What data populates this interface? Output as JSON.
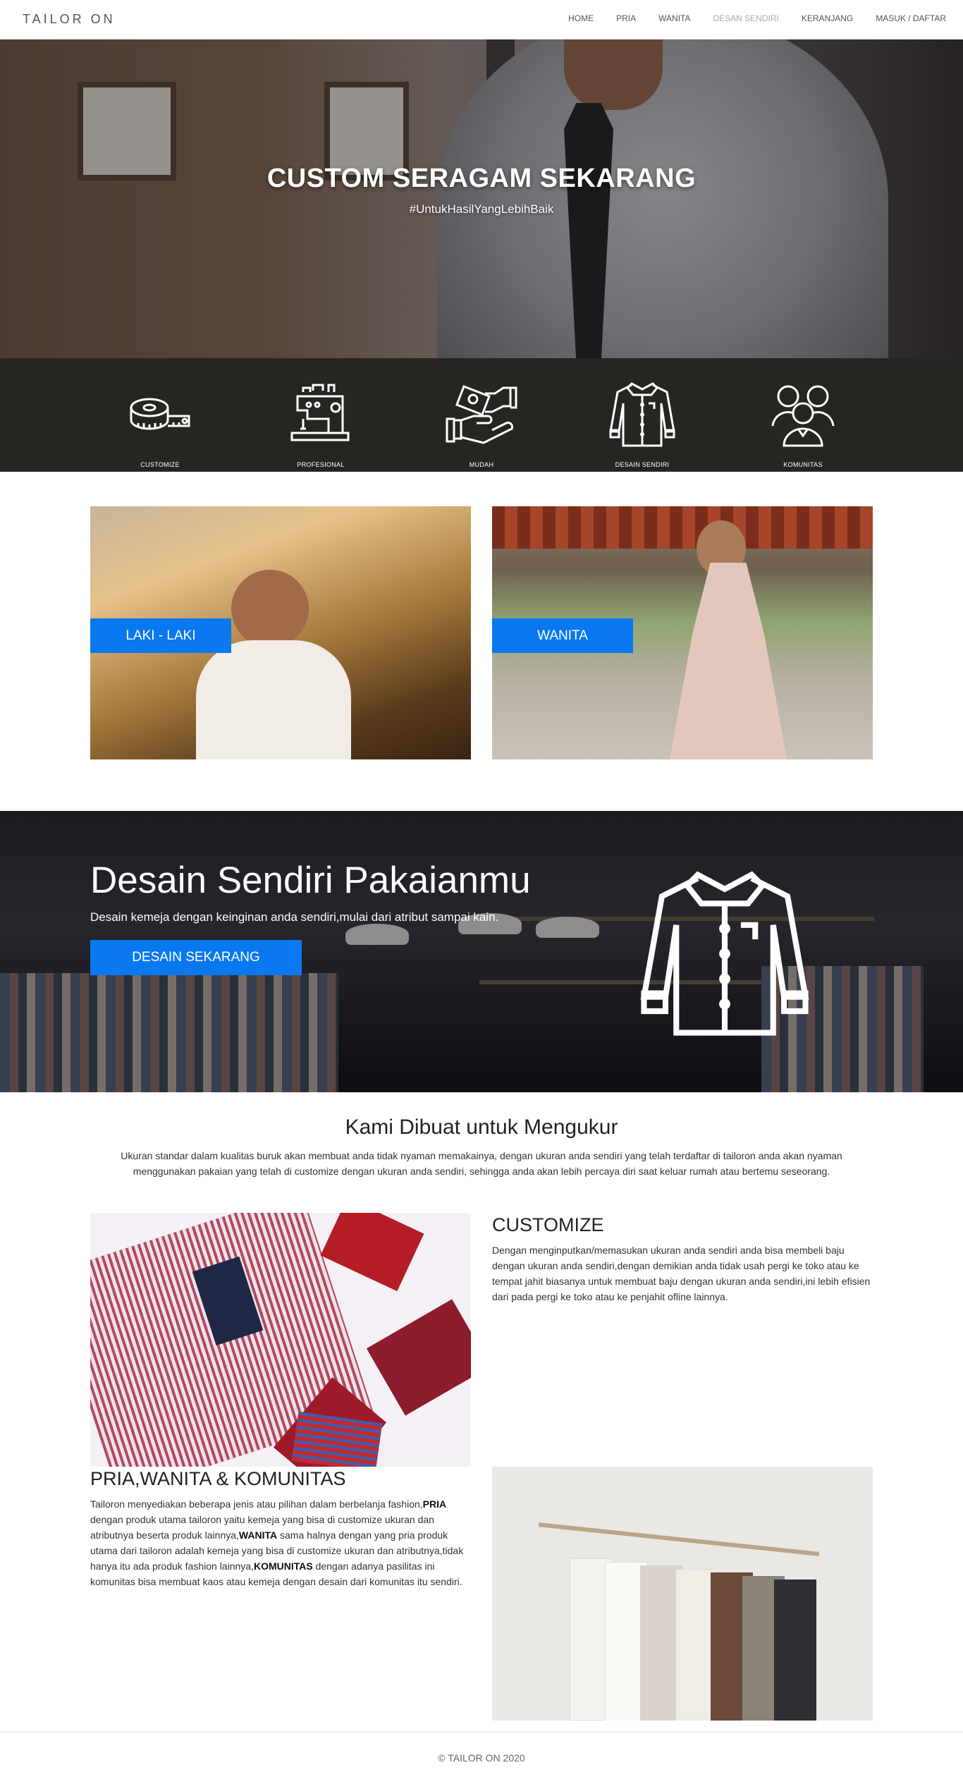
{
  "nav": {
    "brand": "TAILOR ON",
    "items": [
      {
        "label": "HOME"
      },
      {
        "label": "PRIA"
      },
      {
        "label": "WANITA"
      },
      {
        "label": "DESAN SENDIRI"
      },
      {
        "label": "KERANJANG"
      },
      {
        "label": "MASUK / DAFTAR"
      }
    ]
  },
  "hero": {
    "title": "CUSTOM SERAGAM SEKARANG",
    "subtitle": "#UntukHasilYangLebihBaik"
  },
  "features": [
    {
      "label": "CUSTOMIZE",
      "icon": "measuring-tape-icon"
    },
    {
      "label": "PROFESIONAL",
      "icon": "sewing-machine-icon"
    },
    {
      "label": "MUDAH",
      "icon": "money-hand-icon"
    },
    {
      "label": "DESAIN SENDIRI",
      "icon": "shirt-icon"
    },
    {
      "label": "KOMUNITAS",
      "icon": "community-icon"
    }
  ],
  "categories": {
    "men": "LAKI - LAKI",
    "women": "WANITA"
  },
  "banner": {
    "title": "Desain Sendiri Pakaianmu",
    "description": "Desain kemeja dengan keinginan anda sendiri,mulai dari atribut sampai kain.",
    "button": "DESAIN SEKARANG",
    "icon": "shirt-icon"
  },
  "about": {
    "title": "Kami Dibuat untuk Mengukur",
    "text": "Ukuran standar dalam kualitas buruk akan membuat anda tidak nyaman memakainya, dengan ukuran anda sendiri yang telah terdaftar di tailoron anda akan nyaman menggunakan pakaian yang telah di customize dengan ukuran anda sendiri, sehingga anda akan lebih percaya diri saat keluar rumah atau bertemu seseorang."
  },
  "customize": {
    "title": "CUSTOMIZE",
    "body": "Dengan menginputkan/memasukan ukuran anda sendiri anda bisa membeli baju dengan ukuran anda sendiri,dengan demikian anda tidak usah pergi ke toko atau ke tempat jahit biasanya untuk membuat baju dengan ukuran anda sendiri,ini lebih efisien dari pada pergi ke toko atau ke penjahit ofline lainnya."
  },
  "community": {
    "title": "PRIA,WANITA & KOMUNITAS",
    "p1": "Tailoron menyediakan beberapa jenis atau pilihan dalam berbelanja fashion,",
    "b1": "PRIA",
    "p2": " dengan produk utama tailoron yaitu kemeja yang bisa di customize ukuran dan atributnya beserta produk lainnya,",
    "b2": "WANITA",
    "p3": " sama halnya dengan yang pria produk utama dari tailoron adalah kemeja yang bisa di customize ukuran dan atributnya,tidak hanya itu ada produk fashion lainnya,",
    "b3": "KOMUNITAS",
    "p4": " dengan adanya pasilitas ini komunitas bisa membuat kaos atau kemeja dengan desain dari komunitas itu sendiri."
  },
  "footer": {
    "copyright": "© TAILOR ON 2020"
  }
}
